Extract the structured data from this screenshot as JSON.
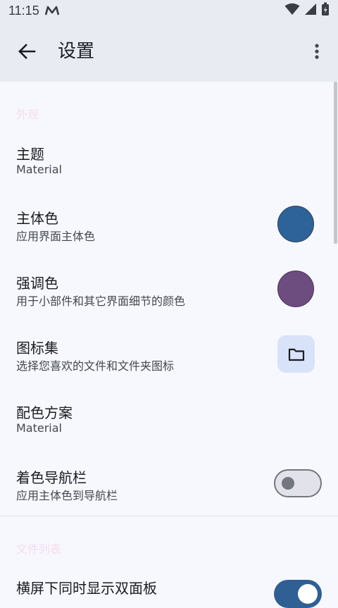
{
  "status": {
    "time": "11:15"
  },
  "appbar": {
    "title": "设置"
  },
  "sections": {
    "appearance": "外观",
    "file_list": "文件列表"
  },
  "settings": {
    "theme": {
      "label": "主题",
      "summary": "Material"
    },
    "primary_color": {
      "label": "主体色",
      "summary": "应用界面主体色",
      "color": "#2d6399"
    },
    "accent_color": {
      "label": "强调色",
      "summary": "用于小部件和其它界面细节的颜色",
      "color": "#6d4d7f"
    },
    "icon_set": {
      "label": "图标集",
      "summary": "选择您喜欢的文件和文件夹图标",
      "icon": "folder-icon"
    },
    "color_scheme": {
      "label": "配色方案",
      "summary": "Material"
    },
    "tint_nav_bar": {
      "label": "着色导航栏",
      "summary": "应用主体色到导航栏",
      "enabled": false
    },
    "dual_pane": {
      "label": "横屏下同时显示双面板",
      "enabled": true
    }
  }
}
